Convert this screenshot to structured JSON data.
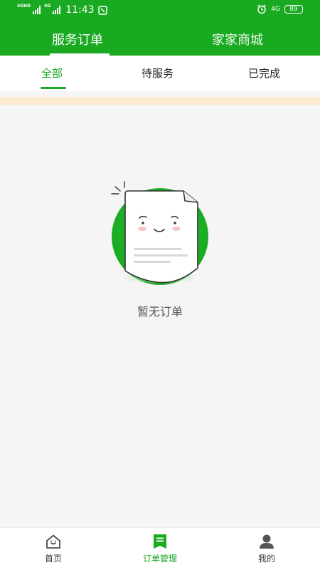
{
  "status_bar": {
    "network1": "4GHD",
    "network2": "4G",
    "time": "11:43",
    "network3": "4G",
    "battery": "89"
  },
  "top_tabs": [
    {
      "label": "服务订单",
      "active": true
    },
    {
      "label": "家家商城",
      "active": false
    }
  ],
  "sub_tabs": [
    {
      "label": "全部",
      "active": true
    },
    {
      "label": "待服务",
      "active": false
    },
    {
      "label": "已完成",
      "active": false
    }
  ],
  "empty_state": {
    "message": "暂无订单",
    "icon": "sad-document-icon"
  },
  "bottom_nav": [
    {
      "label": "首页",
      "icon": "home-icon",
      "active": false
    },
    {
      "label": "订单管理",
      "icon": "order-list-icon",
      "active": true
    },
    {
      "label": "我的",
      "icon": "profile-icon",
      "active": false
    }
  ],
  "colors": {
    "brand_green": "#1aaa22",
    "notice_strip": "#fbecd1",
    "background": "#f5f5f5"
  }
}
